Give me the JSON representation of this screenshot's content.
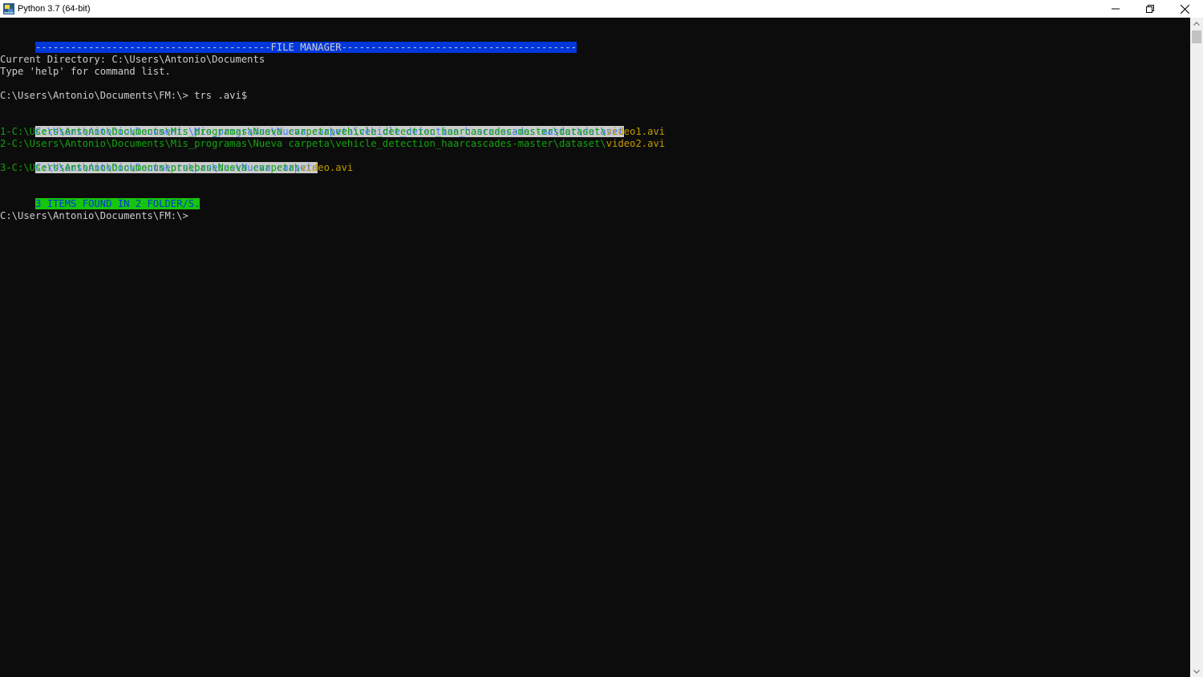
{
  "window": {
    "title": "Python 3.7 (64-bit)"
  },
  "console": {
    "banner": "----------------------------------------FILE MANAGER----------------------------------------",
    "current_directory": "Current Directory: C:\\Users\\Antonio\\Documents",
    "help_hint": "Type 'help' for command list.",
    "command_line": "C:\\Users\\Antonio\\Documents\\FM:\\> trs .avi$",
    "results": [
      {
        "folder": "C:\\Users\\Antonio\\Documents\\Mis_programas\\Nueva carpeta\\vehicle_detection_haarcascades-master\\dataset",
        "files": [
          {
            "path": "1-C:\\Users\\Antonio\\Documents\\Mis_programas\\Nueva carpeta\\vehicle_detection_haarcascades-master\\dataset\\",
            "name": "video1.avi"
          },
          {
            "path": "2-C:\\Users\\Antonio\\Documents\\Mis_programas\\Nueva carpeta\\vehicle_detection_haarcascades-master\\dataset\\",
            "name": "video2.avi"
          }
        ]
      },
      {
        "folder": "C:\\Users\\Antonio\\Documents\\pruebas\\Nueva carpeta",
        "files": [
          {
            "path": "3-C:\\Users\\Antonio\\Documents\\pruebas\\Nueva carpeta\\",
            "name": "video.avi"
          }
        ]
      }
    ],
    "summary": "3 ITEMS FOUND IN 2 FOLDER/S.",
    "prompt": "C:\\Users\\Antonio\\Documents\\FM:\\>"
  },
  "colors": {
    "console_background": "#0c0c0c",
    "console_text": "#cccccc",
    "banner_background": "#0037da",
    "selection_background": "#cccccc",
    "selection_text": "#3b78ff",
    "path_green": "#13a10e",
    "filename_yellow": "#c19c00",
    "summary_background": "#16c60c"
  }
}
